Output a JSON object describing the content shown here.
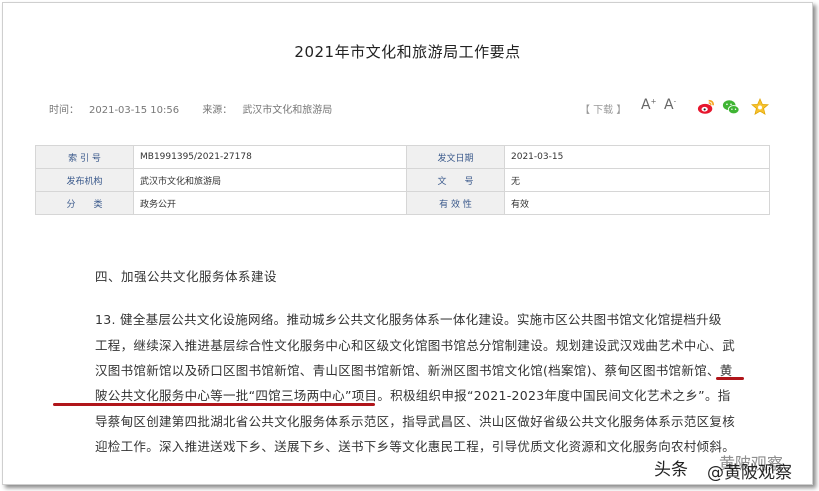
{
  "title": "2021年市文化和旅游局工作要点",
  "meta": {
    "time_label": "时间：",
    "time_value": "2021-03-15 10:56",
    "source_label": "来源：",
    "source_value": "武汉市文化和旅游局",
    "download": "【 下载 】",
    "font_up": "A",
    "font_down": "A"
  },
  "share_icons": [
    "weibo-icon",
    "wechat-icon",
    "favorite-star-icon"
  ],
  "info_table": {
    "rows": [
      {
        "l1": "索 引 号",
        "v1": "MB1991395/2021-27178",
        "l2": "发文日期",
        "v2": "2021-03-15"
      },
      {
        "l1": "发布机构",
        "v1": "武汉市文化和旅游局",
        "l2": "文　　号",
        "v2": "无"
      },
      {
        "l1": "分　　类",
        "v1": "政务公开",
        "l2": "有 效 性",
        "v2": "有效"
      }
    ]
  },
  "section_heading": "四、加强公共文化服务体系建设",
  "paragraph_lines": [
    "13. 健全基层公共文化设施网络。推动城乡公共文化服务体系一体化建设。实施市区公共图书馆文化馆提档升级",
    "工程，继续深入推进基层综合性文化服务中心和区级文化馆图书馆总分馆制建设。规划建设武汉戏曲艺术中心、武",
    "汉图书馆新馆以及硚口区图书馆新馆、青山区图书馆新馆、新洲区图书馆文化馆(档案馆)、蔡甸区图书馆新馆、黄",
    "陂公共文化服务中心等一批“四馆三场两中心”项目。积极组织申报“2021-2023年度中国民间文化艺术之乡”。指",
    "导蔡甸区创建第四批湖北省公共文化服务体系示范区，指导武昌区、洪山区做好省级公共文化服务体系示范区复核",
    "迎检工作。深入推进送戏下乡、送展下乡、送书下乡等文化惠民工程，引导优质文化资源和文化服务向农村倾斜。"
  ],
  "watermark": {
    "prefix": "头条",
    "handle": "@黄陂观察",
    "faint": "黄陂观察"
  },
  "colors": {
    "underline": "#b0151a",
    "label_text": "#3b5a8c",
    "label_bg": "#f0f0f0"
  }
}
